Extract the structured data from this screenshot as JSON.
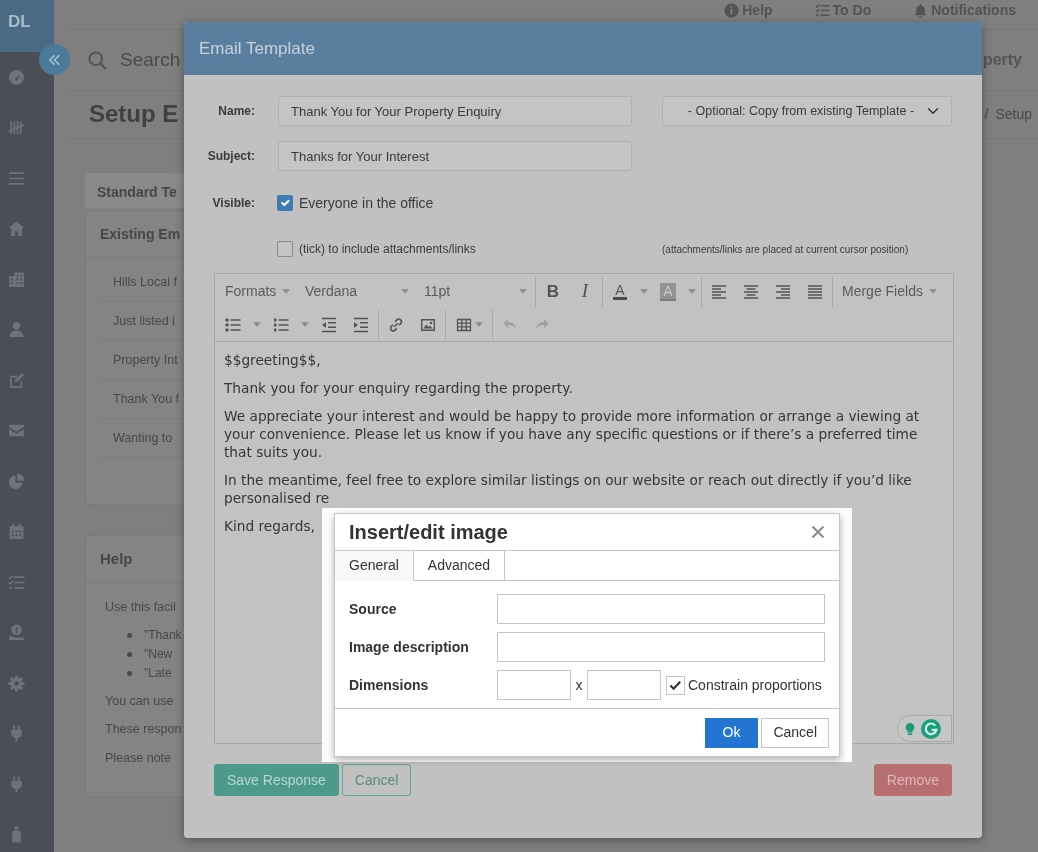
{
  "sidebar": {
    "logo": "DL"
  },
  "header": {
    "links": [
      "Help",
      "To Do",
      "Notifications"
    ],
    "search": {
      "placeholder": "Search"
    },
    "link_fragment": "perty"
  },
  "page": {
    "title": "Setup E",
    "breadcrumb": [
      "/",
      "Setup"
    ]
  },
  "section_tab": "Standard Te",
  "existing_card": {
    "title": "Existing Em",
    "items": [
      "Hills Local f",
      "Just listed i",
      "Property Int",
      "Thank You f",
      "Wanting to"
    ]
  },
  "help_card": {
    "title": "Help",
    "intro": "Use this facil",
    "bullets": [
      "\"Thank",
      "\"New",
      "\"Late"
    ],
    "notes": [
      "You can use",
      "These respon",
      "Please note"
    ]
  },
  "email_modal": {
    "title": "Email Template",
    "fields": [
      {
        "label": "Name:",
        "value": "Thank You for Your Property Enquiry"
      },
      {
        "label": "Subject:",
        "value": "Thanks for Your Interest"
      }
    ],
    "template_select": {
      "value": "- Optional: Copy from existing Template -"
    },
    "visible": {
      "label": "Visible:",
      "option": "Everyone in the office",
      "checked": true
    },
    "attachments": {
      "label": "(tick) to include attachments/links",
      "checked": false,
      "note": "(attachments/links are placed at current cursor position)"
    },
    "editor": {
      "toolbar": {
        "formats": "Formats",
        "font_family": "Verdana",
        "font_size": "11pt",
        "bold": "B",
        "italic": "I",
        "text_color": "A",
        "highlight_color": "A",
        "merge_fields": "Merge Fields",
        "undo": {
          "disabled": true
        },
        "redo": {
          "disabled": true
        }
      },
      "paragraphs": [
        "$$greeting$$,",
        "Thank you for your enquiry regarding the property.",
        "We appreciate your interest and would be happy to provide more information or arrange a viewing at your convenience. Please let us know if you have any specific questions or if there’s a preferred time that suits you.",
        "In the meantime, feel free to explore similar listings on our website or reach out directly if you’d like personalised re",
        "Kind regards,"
      ]
    },
    "buttons": [
      {
        "label": "Save Response",
        "kind": "save"
      },
      {
        "label": "Cancel",
        "kind": "cancel"
      },
      {
        "label": "Remove",
        "kind": "remove"
      }
    ]
  },
  "image_dialog": {
    "title": "Insert/edit image",
    "tabs": [
      {
        "label": "General",
        "selected": true
      },
      {
        "label": "Advanced",
        "selected": false
      }
    ],
    "fields": [
      {
        "label": "Source",
        "kind": "text"
      },
      {
        "label": "Image description",
        "kind": "text"
      },
      {
        "label": "Dimensions",
        "kind": "dimensions",
        "separator": "x",
        "constrain": {
          "label": "Constrain proportions",
          "checked": true
        }
      }
    ],
    "buttons": [
      {
        "label": "Ok",
        "kind": "primary"
      },
      {
        "label": "Cancel",
        "kind": "default"
      }
    ]
  }
}
